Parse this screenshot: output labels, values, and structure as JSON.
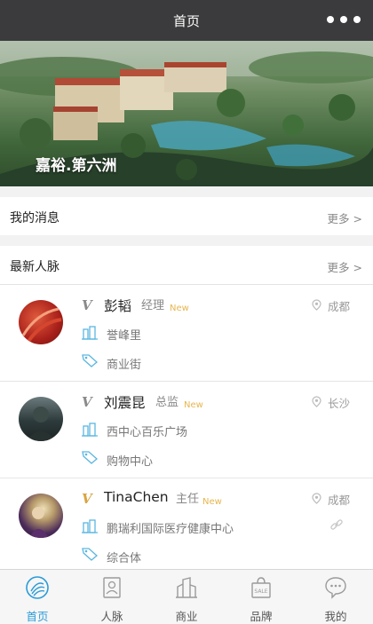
{
  "header": {
    "title": "首页"
  },
  "banner": {
    "caption": "嘉裕.第六洲"
  },
  "messages": {
    "label": "我的消息",
    "more": "更多 >"
  },
  "network": {
    "label": "最新人脉",
    "more": "更多 >"
  },
  "contacts": [
    {
      "name": "彭韬",
      "role": "经理",
      "badge": "New",
      "city": "成都",
      "company": "誉峰里",
      "category": "商业街"
    },
    {
      "name": "刘震昆",
      "role": "总监",
      "badge": "New",
      "city": "长沙",
      "company": "西中心百乐广场",
      "category": "购物中心"
    },
    {
      "name": "TinaChen",
      "role": "主任",
      "badge": "New",
      "city": "成都",
      "company": "鹏瑞利国际医疗健康中心",
      "category": "综合体"
    }
  ],
  "tabs": [
    {
      "label": "首页",
      "icon": "home-icon",
      "active": true
    },
    {
      "label": "人脉",
      "icon": "contacts-icon",
      "active": false
    },
    {
      "label": "商业",
      "icon": "building-icon",
      "active": false
    },
    {
      "label": "品牌",
      "icon": "brand-bag-icon",
      "active": false
    },
    {
      "label": "我的",
      "icon": "chat-profile-icon",
      "active": false
    }
  ],
  "colors": {
    "accent": "#2a9cd8",
    "header": "#3b3b3d",
    "new_badge": "#e7b64e",
    "vip_gold": "#d9a441"
  }
}
